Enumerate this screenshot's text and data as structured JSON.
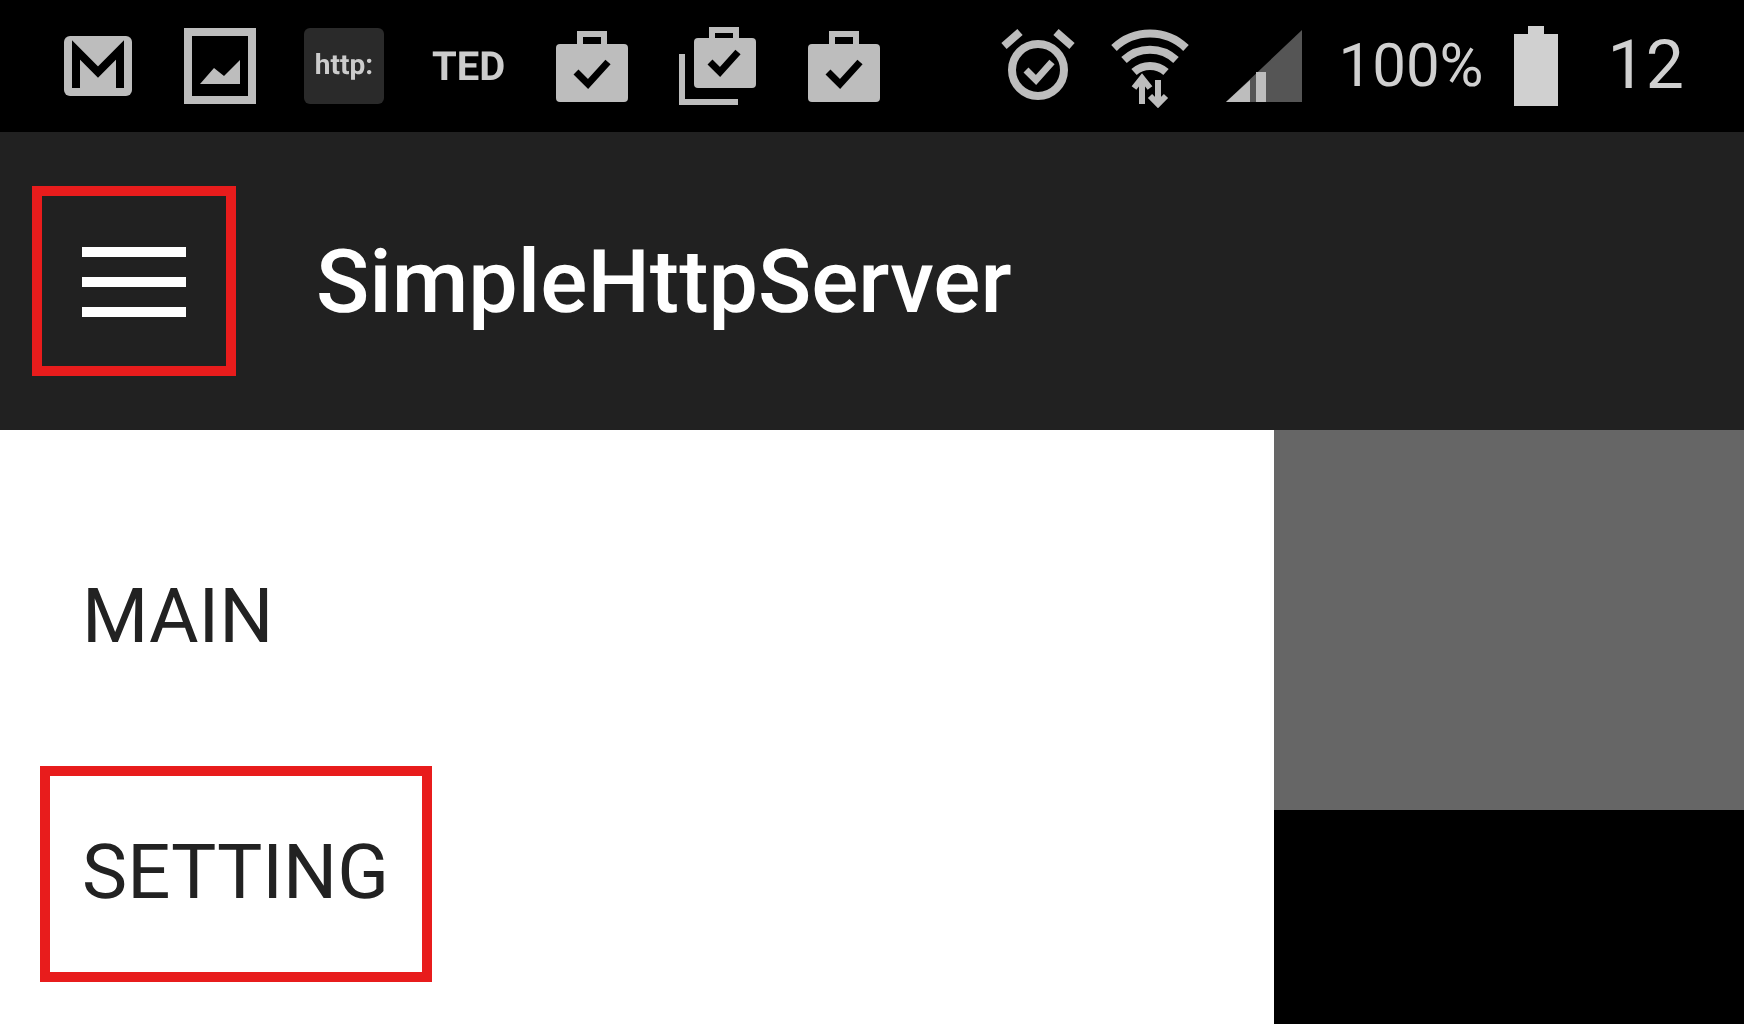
{
  "status_bar": {
    "notification_icons": [
      {
        "kind": "mail"
      },
      {
        "kind": "image"
      },
      {
        "kind": "label",
        "text": "http:"
      },
      {
        "kind": "text",
        "text": "TED"
      },
      {
        "kind": "bag"
      },
      {
        "kind": "bags"
      },
      {
        "kind": "bag"
      }
    ],
    "battery_text": "100%",
    "time": "12"
  },
  "toolbar": {
    "menu_button": {
      "highlighted": true
    },
    "title": "SimpleHttpServer"
  },
  "drawer": {
    "items": [
      {
        "label": "MAIN",
        "highlighted": false
      },
      {
        "label": "SETTING",
        "highlighted": true
      }
    ]
  }
}
